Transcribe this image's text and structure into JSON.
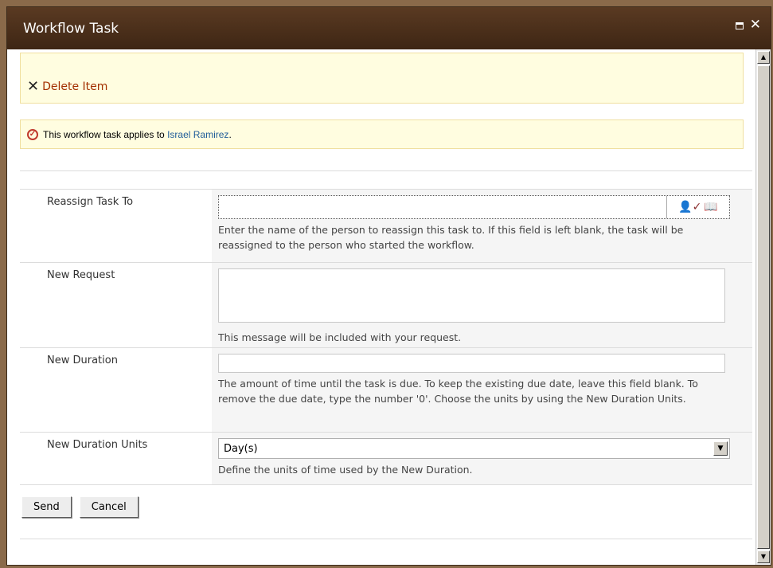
{
  "window": {
    "title": "Workflow Task"
  },
  "ribbon": {
    "delete_label": "Delete Item"
  },
  "notice": {
    "prefix": "This workflow task applies to",
    "person": "Israel Ramirez",
    "suffix": "."
  },
  "fields": {
    "reassign": {
      "label": "Reassign Task To",
      "value": "",
      "hint": "Enter the name of the person to reassign this task to. If this field is left blank, the task will be reassigned to the person who started the workflow."
    },
    "request": {
      "label": "New Request",
      "value": "",
      "hint": "This message will be included with your request."
    },
    "duration": {
      "label": "New Duration",
      "value": "",
      "hint": "The amount of time until the task is due. To keep the existing due date, leave this field blank. To remove the due date, type the number '0'. Choose the units by using the New Duration Units."
    },
    "units": {
      "label": "New Duration Units",
      "selected": "Day(s)",
      "hint": "Define the units of time used by the New Duration."
    }
  },
  "buttons": {
    "send": "Send",
    "cancel": "Cancel"
  }
}
